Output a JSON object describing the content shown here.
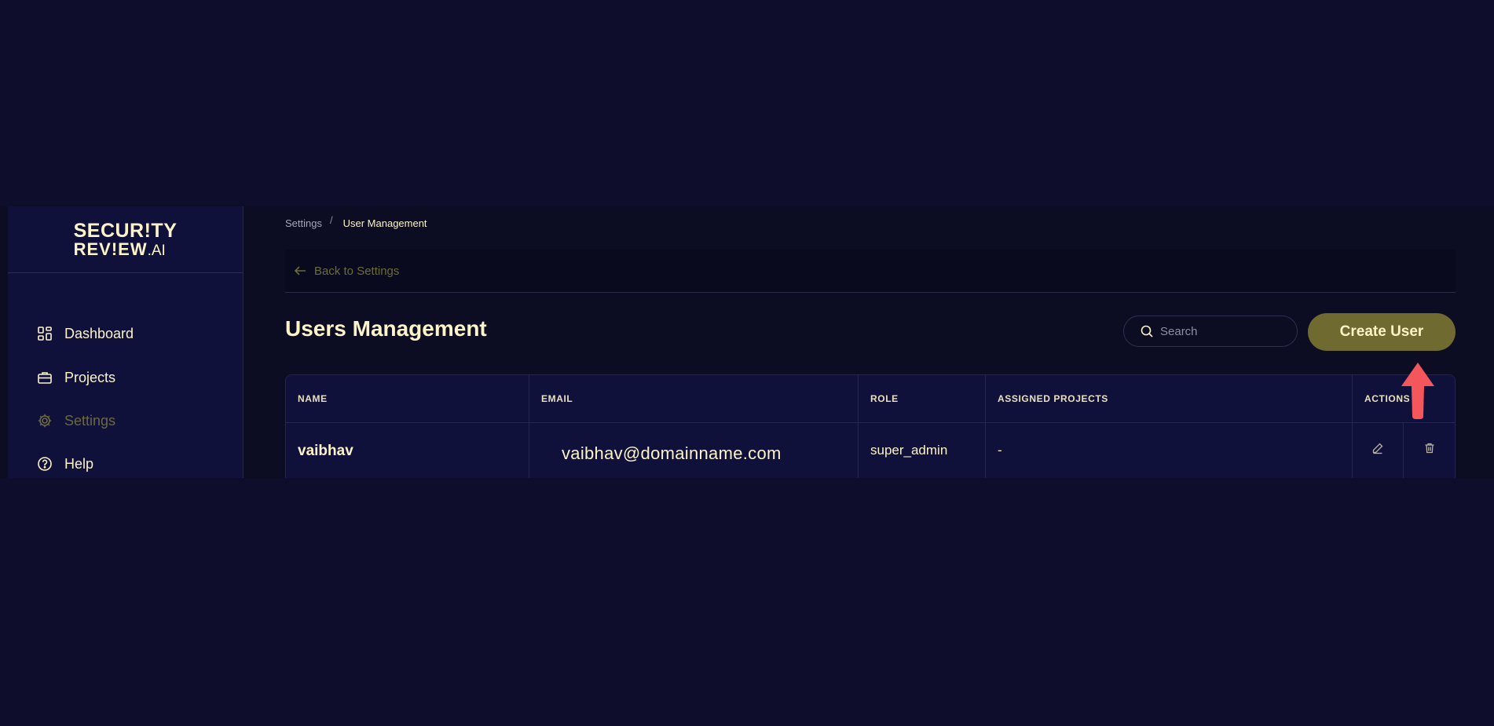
{
  "logo": {
    "line1": "SECUR!TY",
    "line2": "REV!EW",
    "line2_suffix": ".AI"
  },
  "sidebar": {
    "items": [
      {
        "label": "Dashboard",
        "icon": "dashboard-icon"
      },
      {
        "label": "Projects",
        "icon": "briefcase-icon"
      },
      {
        "label": "Settings",
        "icon": "gear-icon",
        "active": true
      },
      {
        "label": "Help",
        "icon": "help-icon"
      }
    ]
  },
  "breadcrumb": {
    "parent": "Settings",
    "separator": "/",
    "current": "User Management"
  },
  "back": {
    "label": "Back to Settings"
  },
  "page": {
    "title": "Users Management"
  },
  "search": {
    "placeholder": "Search"
  },
  "create_button": {
    "label": "Create User"
  },
  "table": {
    "headers": [
      "NAME",
      "EMAIL",
      "ROLE",
      "ASSIGNED PROJECTS",
      "ACTIONS"
    ],
    "rows": [
      {
        "name": "vaibhav",
        "email": "vaibhav@domainname.com",
        "role": "super_admin",
        "projects": "-"
      }
    ]
  },
  "colors": {
    "background": "#0e0d2b",
    "sidebar": "#10113a",
    "accent": "#6f6b30",
    "text": "#fcf3c8",
    "annotation_arrow": "#f4575b"
  }
}
